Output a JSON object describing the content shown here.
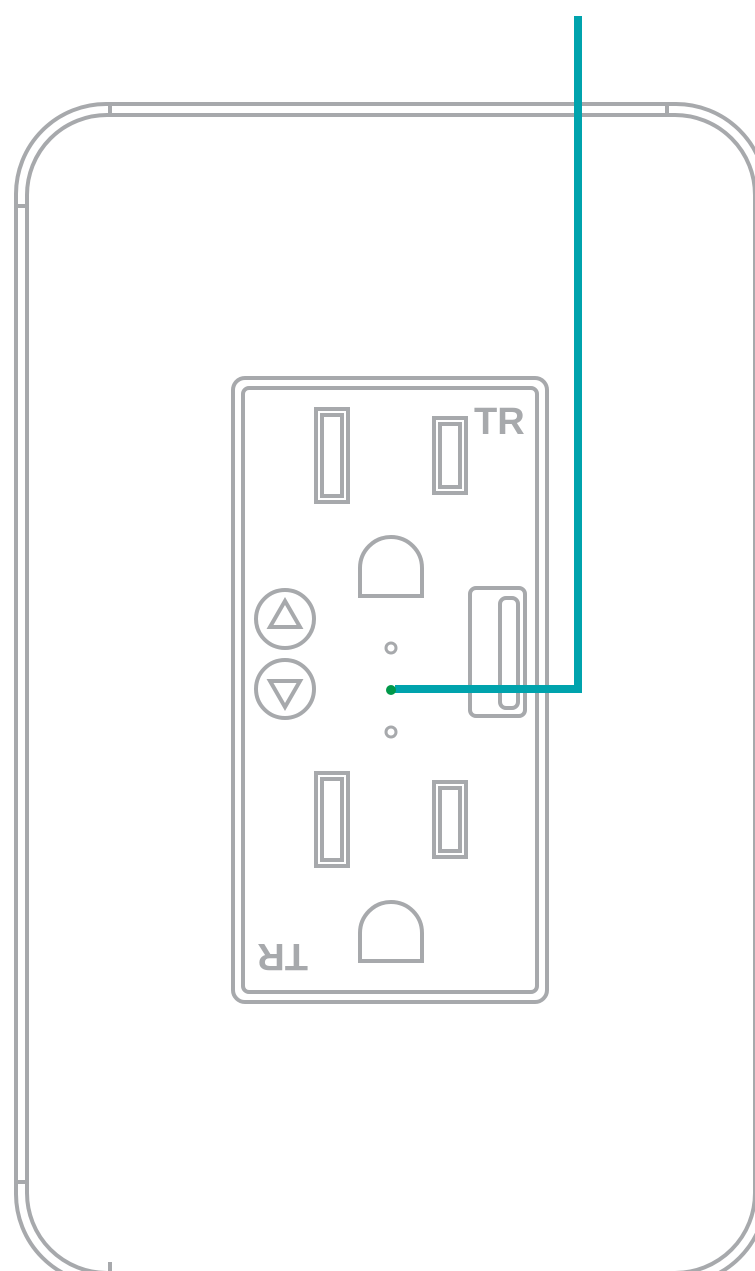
{
  "labels": {
    "top_tr": "TR",
    "bottom_tr": "TR"
  },
  "colors": {
    "outline": "#a7a9ac",
    "callout_line": "#00a3ad",
    "status_led": "#00984a",
    "background": "#ffffff"
  },
  "icons": {
    "up_button": "triangle-up-icon",
    "down_button": "triangle-down-icon"
  }
}
